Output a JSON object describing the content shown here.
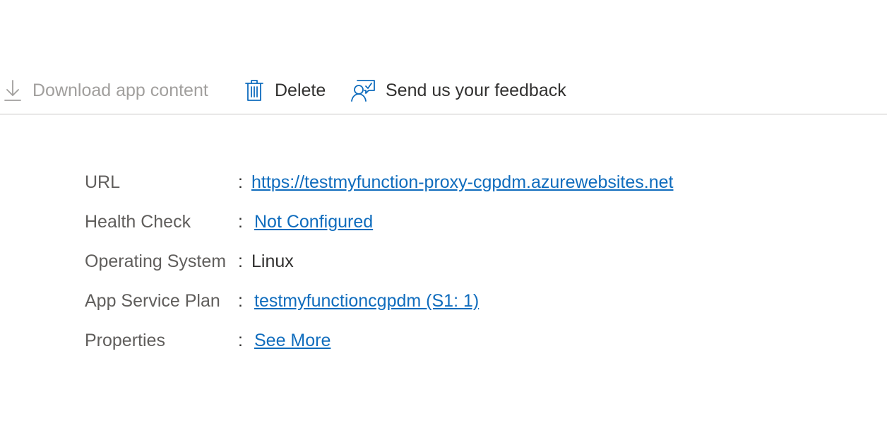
{
  "toolbar": {
    "download": {
      "label": "Download app content",
      "icon": "download-icon",
      "enabled": false
    },
    "delete": {
      "label": "Delete",
      "icon": "trash-icon"
    },
    "feedback": {
      "label": "Send us your feedback",
      "icon": "feedback-icon"
    }
  },
  "essentials": {
    "separator": ":",
    "rows": [
      {
        "label": "URL",
        "value": "https://testmyfunction-proxy-cgpdm.azurewebsites.net",
        "link": true
      },
      {
        "label": "Health Check",
        "value": "Not Configured",
        "link": true
      },
      {
        "label": "Operating System",
        "value": "Linux",
        "link": false
      },
      {
        "label": "App Service Plan",
        "value": "testmyfunctioncgpdm (S1: 1)",
        "link": true
      },
      {
        "label": "Properties",
        "value": "See More",
        "link": true
      }
    ]
  },
  "colors": {
    "accent": "#0f6cbd",
    "text": "#323130",
    "label": "#605e5c",
    "disabled": "#a19f9d",
    "divider": "#c8c6c4"
  }
}
